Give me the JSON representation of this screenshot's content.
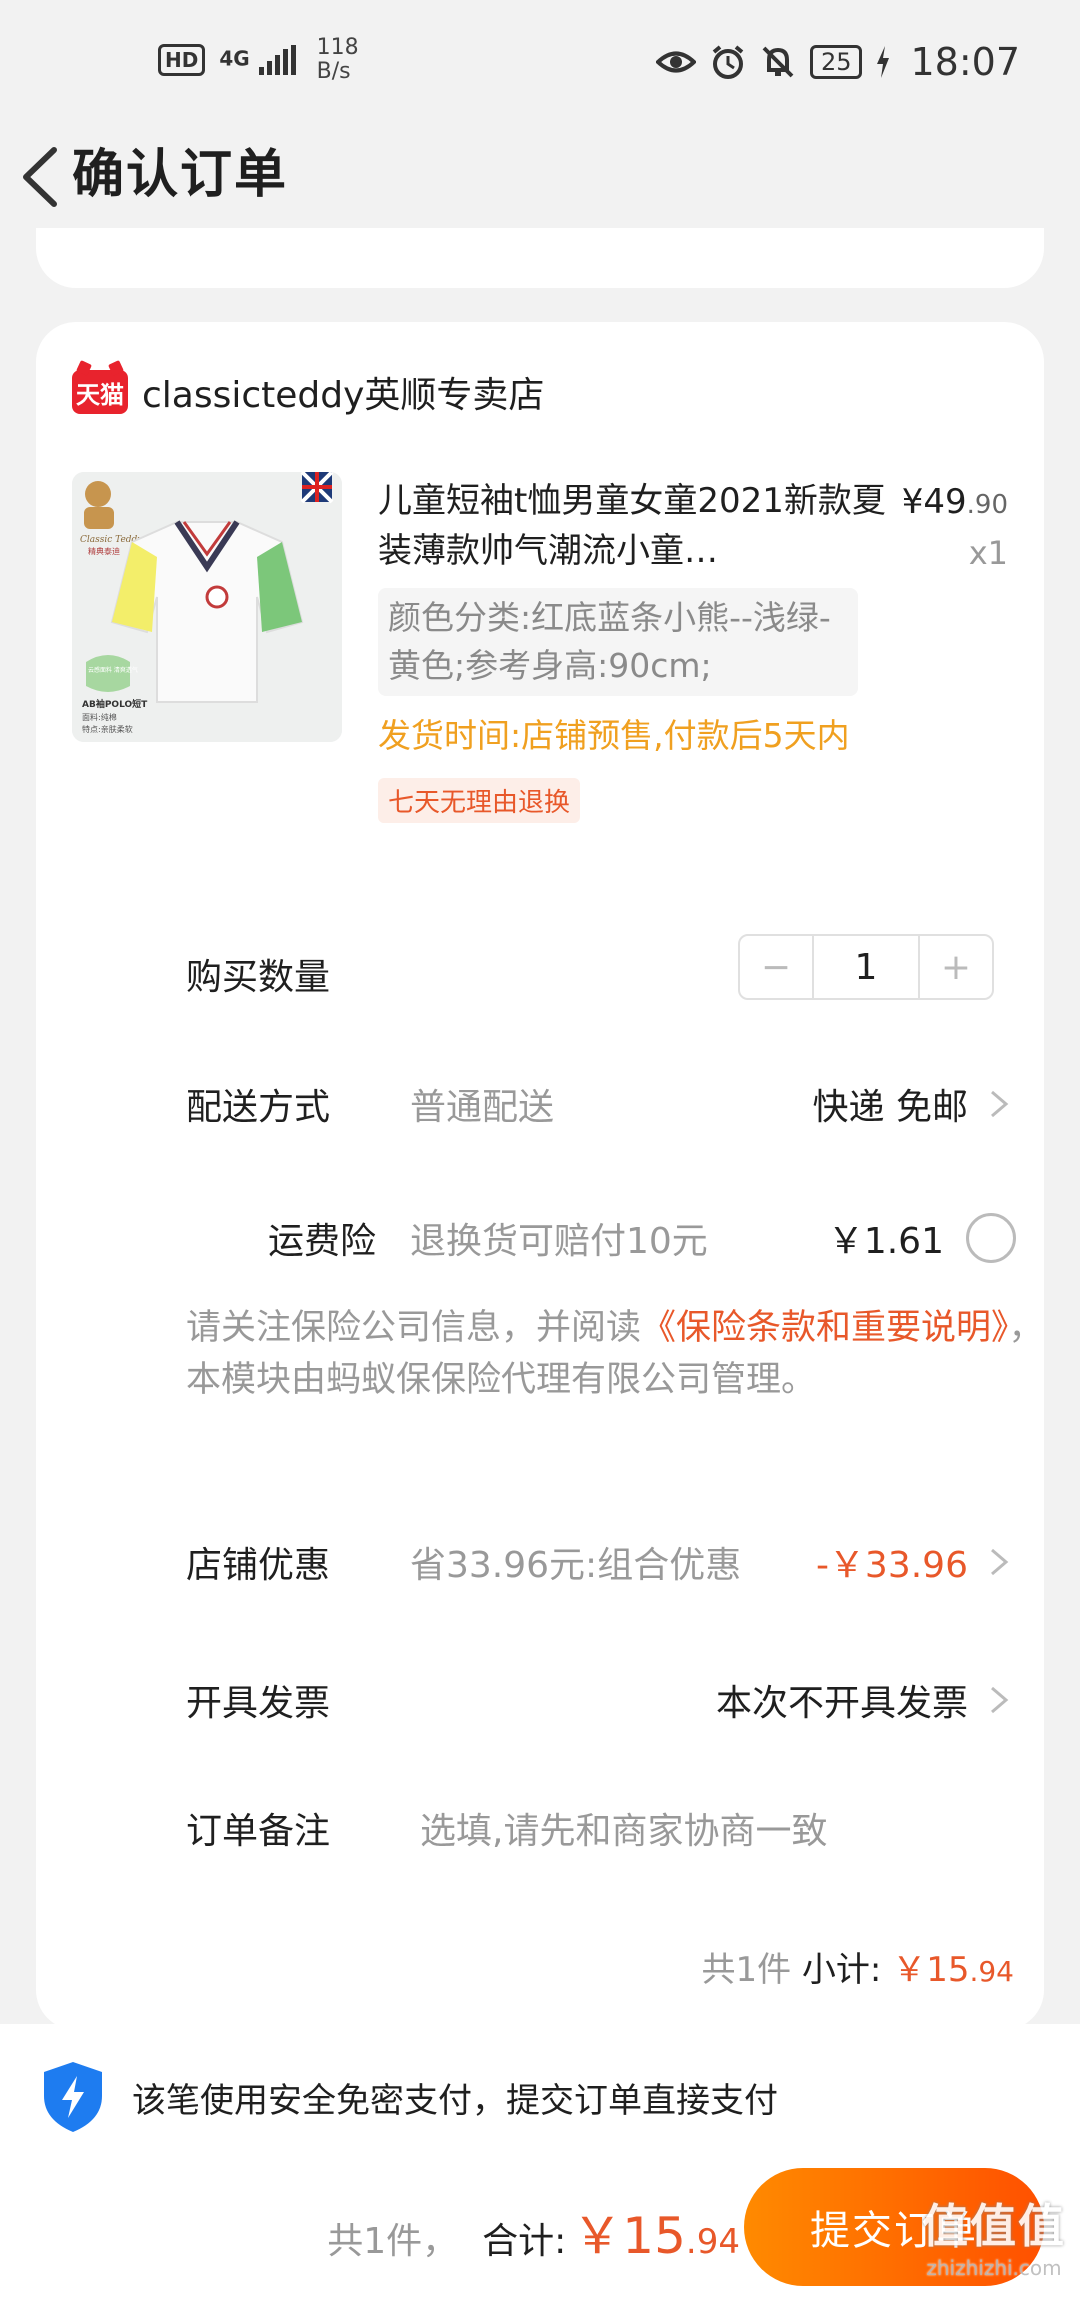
{
  "status_bar": {
    "hd": "HD",
    "network": "4G",
    "speed": "118",
    "speed_unit": "B/s",
    "battery": "25",
    "time": "18:07"
  },
  "header": {
    "title": "确认订单"
  },
  "shop": {
    "platform_badge": "天猫",
    "name": "classicteddy英顺专卖店"
  },
  "product": {
    "title": "儿童短袖t恤男童女童2021新款夏装薄款帅气潮流小童…",
    "sku": "颜色分类:红底蓝条小熊--浅绿-黄色;参考身高:90cm;",
    "ship_time": "发货时间:店铺预售,付款后5天内",
    "tag": "七天无理由退换",
    "price_int": "¥49",
    "price_dec": ".90",
    "qty": "x1",
    "image_text": {
      "brand": "Classic Teddy",
      "brand_cn": "精典泰迪",
      "badge": "云感面料 清爽透气",
      "line1": "AB袖POLO短T",
      "line2": "面料:纯棉",
      "line3": "特点:亲肤柔软"
    }
  },
  "quantity": {
    "label": "购买数量",
    "minus": "−",
    "value": "1",
    "plus": "+"
  },
  "delivery": {
    "label": "配送方式",
    "sub": "普通配送",
    "value": "快递 免邮"
  },
  "insurance": {
    "label": "运费险",
    "sub": "退换货可赔付10元",
    "value": "￥1.61"
  },
  "notice": {
    "pre": "请关注保险公司信息，并阅读",
    "link": "《保险条款和重要说明》",
    "post": "，本模块由蚂蚁保保险代理有限公司管理。"
  },
  "discount": {
    "label": "店铺优惠",
    "sub": "省33.96元:组合优惠",
    "value": "-￥33.96"
  },
  "invoice": {
    "label": "开具发票",
    "value": "本次不开具发票"
  },
  "remark": {
    "label": "订单备注",
    "placeholder": "选填,请先和商家协商一致"
  },
  "subtotal": {
    "count": "共1件",
    "label": "小计:",
    "amount_int": "￥15",
    "amount_dec": ".94"
  },
  "bottom": {
    "secure_text": "该笔使用安全免密支付，提交订单直接支付",
    "total_count": "共1件，",
    "total_label": "合计:",
    "total_int": "￥15",
    "total_dec": ".94",
    "submit": "提交订单"
  },
  "watermark": {
    "main": "值值值",
    "sub": "zhizhizhi.com"
  },
  "colors": {
    "accent": "#e8582a",
    "submit_start": "#ff8a00",
    "submit_end": "#ff5000",
    "ship_time": "#f0a020",
    "tmall_red": "#e8232d",
    "shield_blue": "#1e7cf0"
  }
}
